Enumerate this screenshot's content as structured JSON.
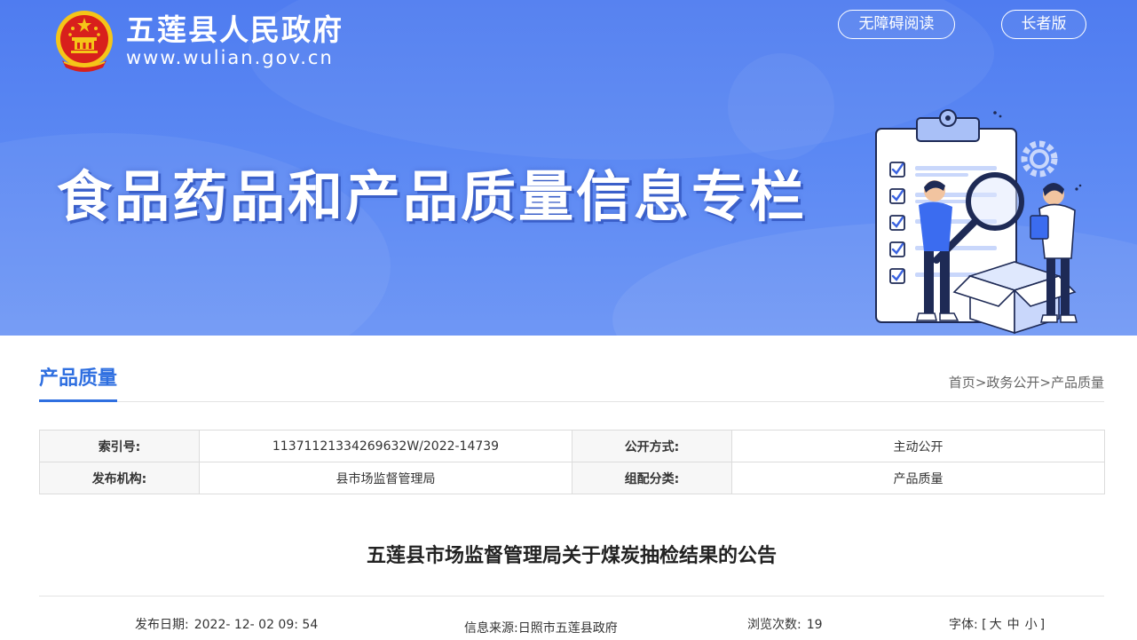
{
  "header": {
    "site_name": "五莲县人民政府",
    "site_url": "www.wulian.gov.cn",
    "accessibility_button": "无障碍阅读",
    "elder_button": "长者版"
  },
  "banner": {
    "title": "食品药品和产品质量信息专栏"
  },
  "section": {
    "title": "产品质量",
    "breadcrumb": {
      "home": "首页",
      "sep1": ">",
      "gov_open": "政务公开",
      "sep2": ">",
      "current": "产品质量"
    }
  },
  "meta": {
    "index_label": "索引号:",
    "index_value": "1137112133426963​2W/2022-14739",
    "open_mode_label": "公开方式:",
    "open_mode_value": "主动公开",
    "publisher_label": "发布机构:",
    "publisher_value": "县市场监督管理局",
    "category_label": "组配分类:",
    "category_value": "产品质量"
  },
  "article": {
    "title": "五莲县市场监督管理局关于煤炭抽检结果的公告",
    "date_label": "发布日期:",
    "date_value": "2022- 12- 02 09: 54",
    "source_label": "信息来源:",
    "source_value": "日照市五莲县政府",
    "views_label": "浏览次数:",
    "views_value": "19",
    "font_label": "字体:",
    "font_open": "[",
    "font_large": "大",
    "font_medium": "中",
    "font_small": "小",
    "font_close": "]"
  },
  "colors": {
    "banner_blue": "#5b88f3",
    "accent_blue": "#2f6fe0",
    "emblem_red": "#d8201c",
    "emblem_gold": "#f5c518"
  }
}
